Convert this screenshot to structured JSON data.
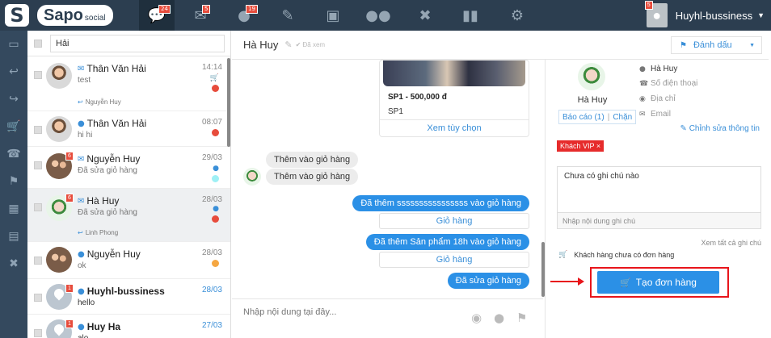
{
  "brand": {
    "logo_letter": "S",
    "logo_word": "Sapo",
    "logo_suffix": "social"
  },
  "topnav": {
    "chat_badge": "24",
    "mail_badge": "5",
    "comment_badge": "19",
    "icons": [
      "chat-icon",
      "mail-icon",
      "comment-icon",
      "edit-icon",
      "card-icon",
      "users-icon",
      "user-block-icon",
      "stats-icon",
      "settings-icon"
    ]
  },
  "user": {
    "name": "Huyhl-bussiness",
    "badge": "5"
  },
  "sidebar": {
    "icons": [
      "inbox-icon",
      "reply-icon",
      "forward-icon",
      "cart-icon",
      "phone-icon",
      "tag-icon",
      "calendar-icon",
      "id-card-icon",
      "close-icon"
    ]
  },
  "search": {
    "value": "Hải",
    "placeholder": ""
  },
  "conversations": [
    {
      "name": "Thân Văn Hải",
      "snippet": "test",
      "time": "14:14",
      "assignee": "Nguyễn Huy",
      "channel": "email"
    },
    {
      "name": "Thân Văn Hải",
      "snippet": "hi hi",
      "time": "08:07",
      "channel": "messenger"
    },
    {
      "name": "Nguyễn Huy",
      "snippet": "Đã sửa giỏ hàng",
      "time": "29/03",
      "unread": "6",
      "channel": "email"
    },
    {
      "name": "Hà Huy",
      "snippet": "Đã sửa giỏ hàng",
      "time": "28/03",
      "unread": "6",
      "assignee": "Linh Phong",
      "channel": "email"
    },
    {
      "name": "Nguyễn Huy",
      "snippet": "ok",
      "time": "28/03",
      "channel": "messenger"
    },
    {
      "name": "Huyhl-bussiness",
      "snippet": "hello",
      "time": "28/03",
      "unread": "1",
      "channel": "messenger"
    },
    {
      "name": "Huy Ha",
      "snippet": "alo",
      "time": "27/03",
      "unread": "1",
      "channel": "messenger"
    }
  ],
  "chat": {
    "title": "Hà Huy",
    "seen": "Đã xem",
    "mark_label": "Đánh dấu",
    "product": {
      "name": "SP1 - 500,000 đ",
      "sku": "SP1",
      "option_button": "Xem tùy chọn"
    },
    "incoming": [
      "Thêm vào giỏ hàng",
      "Thêm vào giỏ hàng"
    ],
    "outgoing": [
      {
        "text": "Đã thêm ssssssssssssssss vào giỏ hàng",
        "button": "Giỏ hàng"
      },
      {
        "text": "Đã thêm Sản phẩm 18h vào giỏ hàng",
        "button": "Giỏ hàng"
      },
      {
        "text": "Đã sửa giỏ hàng"
      }
    ],
    "composer_placeholder": "Nhập nội dung tại đây..."
  },
  "customer": {
    "name": "Hà Huy",
    "report_link": "Báo cáo (1)",
    "block_link": "Chặn",
    "info_name": "Hà Huy",
    "phone_placeholder": "Số điện thoại",
    "address_placeholder": "Địa chỉ",
    "email_placeholder": "Email",
    "edit_info": "Chỉnh sửa thông tin",
    "tag": "Khách VIP",
    "note_text": "Chưa có ghi chú nào",
    "note_placeholder": "Nhập nội dung ghi chú",
    "see_notes": "Xem tất cả ghi chú",
    "no_orders": "Khách hàng chưa có đơn hàng",
    "create_order": "Tạo đơn hàng"
  },
  "colors": {
    "topbar": "#2c3e50",
    "accent": "#2b90e6",
    "highlight": "#e8151b"
  }
}
